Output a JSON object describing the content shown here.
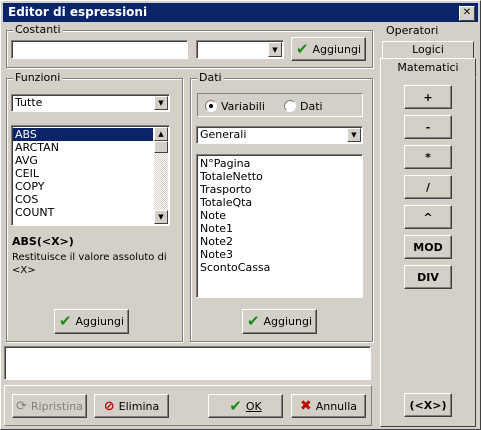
{
  "window": {
    "title": "Editor di espressioni",
    "close_glyph": "✕"
  },
  "costanti": {
    "label": "Costanti",
    "input_value": "",
    "combo_value": "",
    "add_label": "Aggiungi"
  },
  "funzioni": {
    "label": "Funzioni",
    "filter": "Tutte",
    "items": [
      "ABS",
      "ARCTAN",
      "AVG",
      "CEIL",
      "COPY",
      "COS",
      "COUNT"
    ],
    "selected_index": 0,
    "signature": "ABS(<X>)",
    "description": "Restituisce il valore assoluto di <X>",
    "add_label": "Aggiungi"
  },
  "dati": {
    "label": "Dati",
    "radio_variabili": "Variabili",
    "radio_dati": "Dati",
    "selected_radio": "Variabili",
    "category": "Generali",
    "items": [
      "N°Pagina",
      "TotaleNetto",
      "Trasporto",
      "TotaleQta",
      "Note",
      "Note1",
      "Note2",
      "Note3",
      "ScontoCassa"
    ],
    "add_label": "Aggiungi"
  },
  "expression": {
    "value": ""
  },
  "footer": {
    "ripristina": "Ripristina",
    "elimina": "Elimina",
    "ok": "OK",
    "annulla": "Annulla"
  },
  "operatori": {
    "label": "Operatori",
    "tabs": [
      "Logici",
      "Matematici"
    ],
    "active_tab": "Matematici",
    "buttons": [
      "+",
      "-",
      "*",
      "/",
      "^",
      "MOD",
      "DIV"
    ],
    "paren_button": "(<X>)"
  },
  "colors": {
    "titlebar": "#0a246a",
    "face": "#d4d0c8",
    "selection": "#0a246a",
    "ok_check": "#1a8a1a",
    "delete_red": "#c00000"
  }
}
